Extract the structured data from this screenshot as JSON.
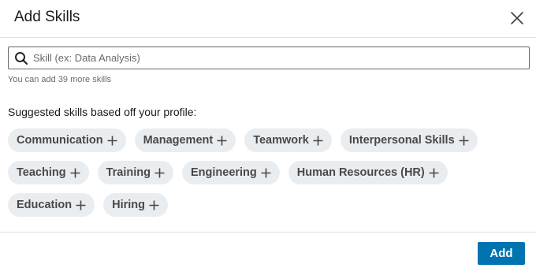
{
  "dialog": {
    "title": "Add Skills",
    "close_icon": "close-icon"
  },
  "search": {
    "placeholder": "Skill (ex: Data Analysis)",
    "value": "",
    "icon": "search-icon"
  },
  "hint": "You can add 39 more skills",
  "suggestions": {
    "heading": "Suggested skills based off your profile:",
    "rows": [
      [
        "Communication",
        "Management",
        "Teamwork",
        "Interpersonal Skills"
      ],
      [
        "Teaching",
        "Training",
        "Engineering",
        "Human Resources (HR)"
      ],
      [
        "Education",
        "Hiring"
      ]
    ],
    "add_icon": "plus-icon"
  },
  "footer": {
    "add_label": "Add"
  },
  "colors": {
    "primary": "#0073b1",
    "chip_bg": "#eaedf0",
    "divider": "#e0e0e0"
  }
}
